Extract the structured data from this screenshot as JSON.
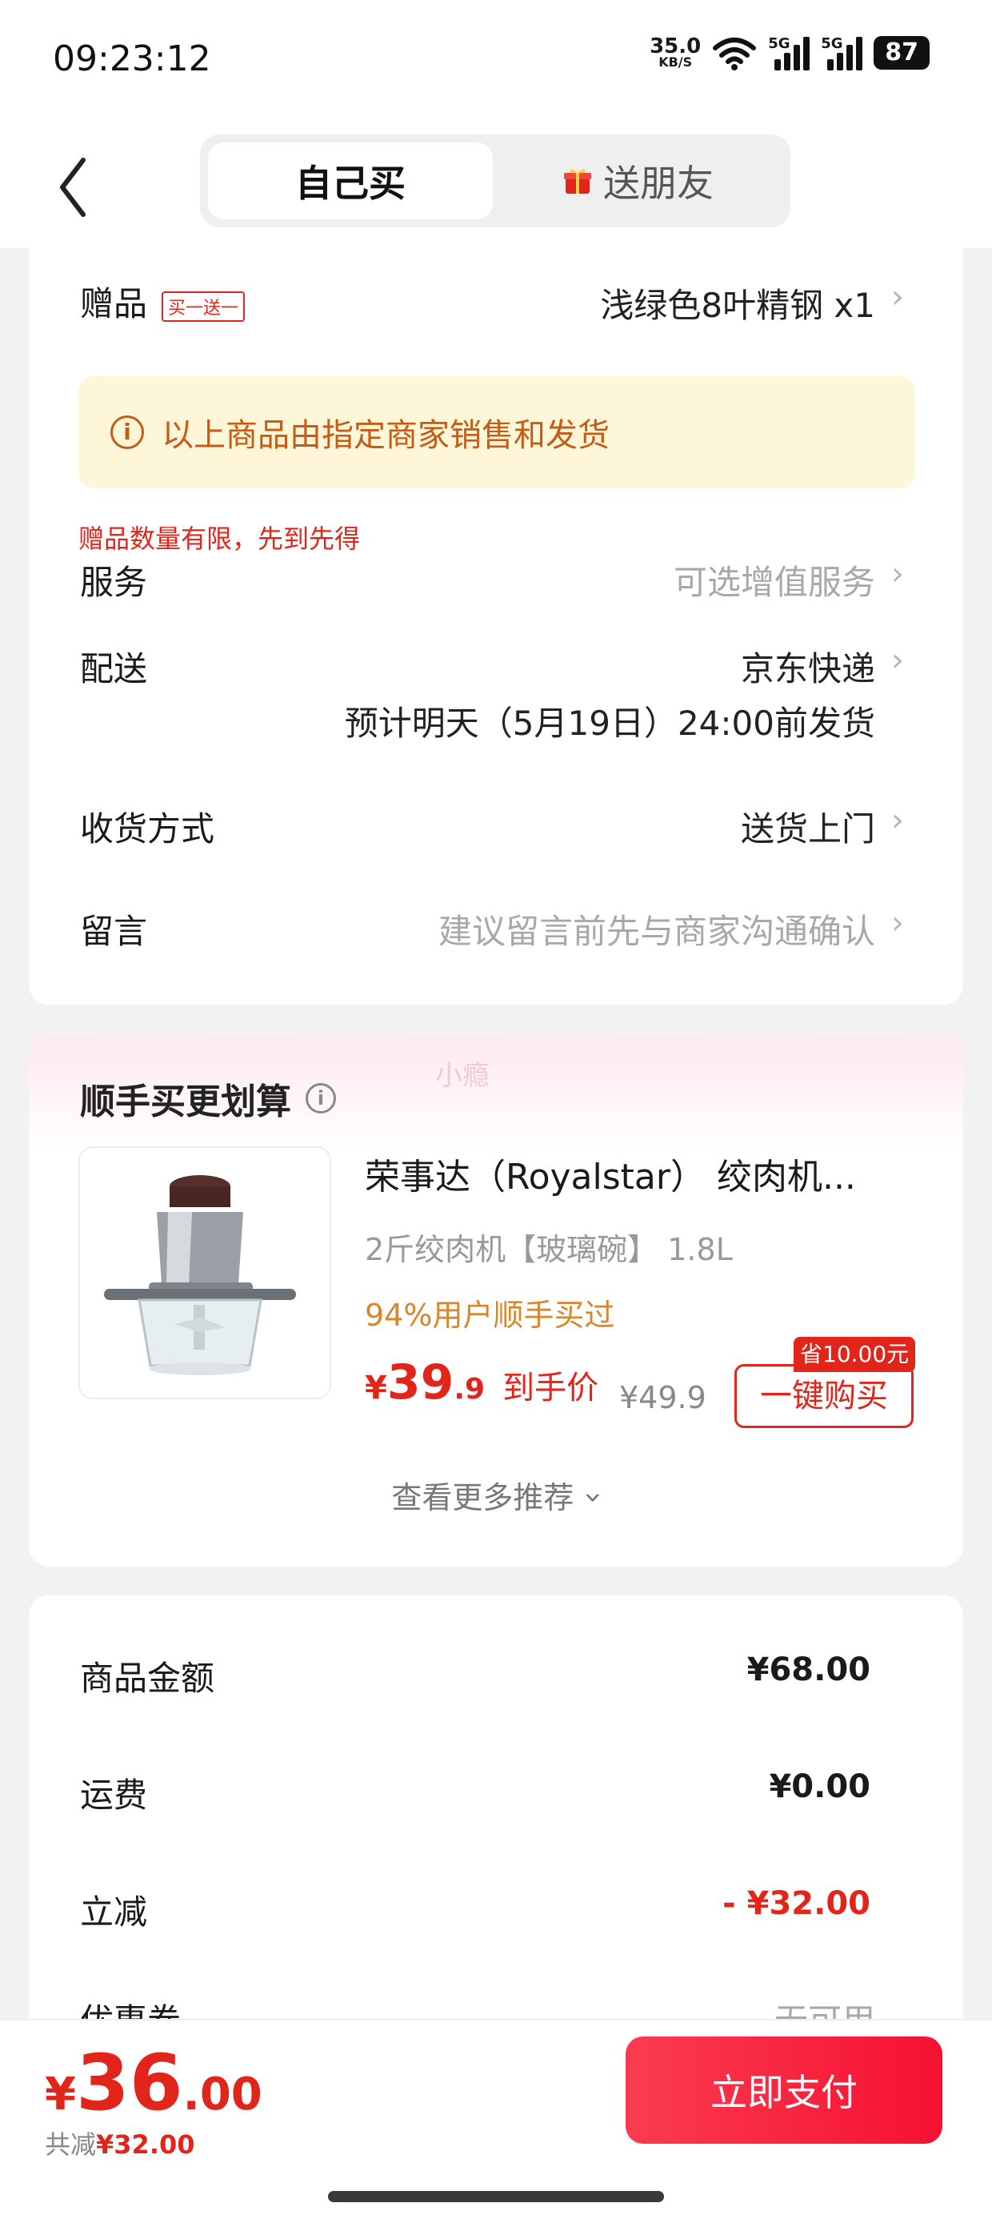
{
  "status_bar": {
    "time": "09:23:12",
    "net_speed": "35.0",
    "net_unit": "KB/S",
    "signal1_tag": "5G",
    "signal2_tag": "5G",
    "battery": "87"
  },
  "header": {
    "tab_self": "自己买",
    "tab_gift": "送朋友"
  },
  "order_info": {
    "gift_label": "赠品",
    "gift_badge": "买一送一",
    "gift_value": "浅绿色8叶精钢 x1",
    "notice": "以上商品由指定商家销售和发货",
    "gift_warning": "赠品数量有限，先到先得",
    "service_label": "服务",
    "service_value": "可选增值服务",
    "delivery_label": "配送",
    "delivery_value": "京东快递",
    "delivery_estimate": "预计明天（5月19日）24:00前发货",
    "receive_label": "收货方式",
    "receive_value": "送货上门",
    "message_label": "留言",
    "message_placeholder": "建议留言前先与商家沟通确认"
  },
  "recommend": {
    "title": "顺手买更划算",
    "watermark": "小瘾",
    "product_title": "荣事达（Royalstar） 绞肉机...",
    "product_spec": "2斤绞肉机【玻璃碗】 1.8L",
    "product_hot": "94%用户顺手买过",
    "price_yen": "¥",
    "price_int": "39",
    "price_dec": ".9",
    "price_label": "到手价",
    "orig_price": "¥49.9",
    "save_tag": "省10.00元",
    "buy_button": "一键购买",
    "more": "查看更多推荐"
  },
  "summary": {
    "goods_label": "商品金额",
    "goods_value": "¥68.00",
    "shipping_label": "运费",
    "shipping_value": "¥0.00",
    "discount_label": "立减",
    "discount_value": "- ¥32.00",
    "coupon_label": "优惠券",
    "coupon_value": "无可用"
  },
  "bottom_bar": {
    "total_yen": "¥",
    "total_int": "36",
    "total_dec": ".00",
    "saved_label": "共减",
    "saved_value": "¥32.00",
    "pay_button": "立即支付"
  },
  "colors": {
    "accent_red": "#e1251b",
    "notice_bg": "#fdf6d9",
    "notice_text": "#c75b14",
    "pay_button": "#f51131"
  }
}
